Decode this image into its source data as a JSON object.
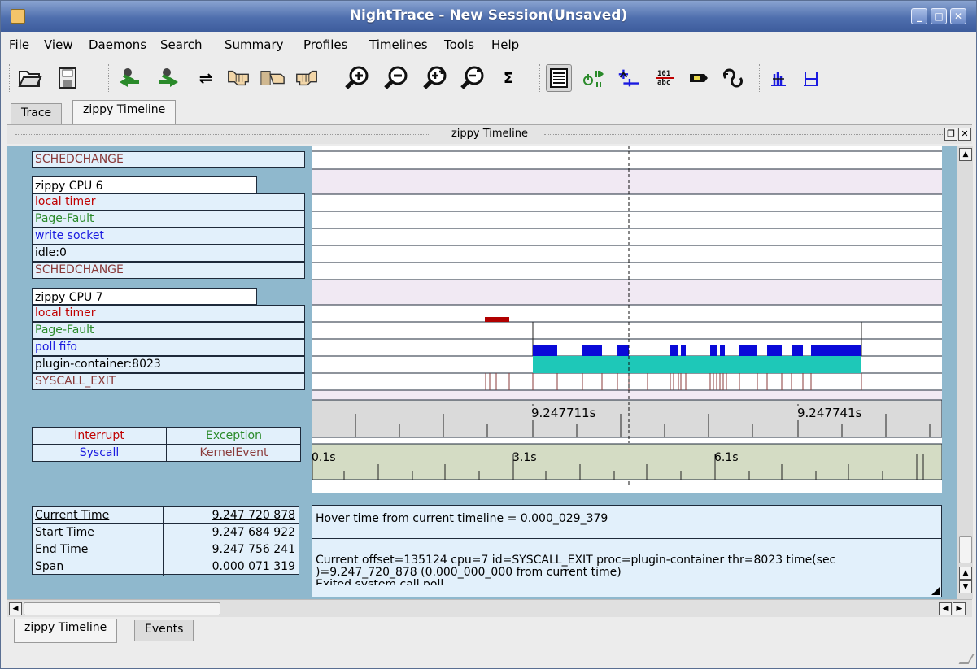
{
  "window": {
    "title": "NightTrace - New Session(Unsaved)"
  },
  "menu": [
    "File",
    "View",
    "Daemons",
    "Search",
    "Summary",
    "Profiles",
    "Timelines",
    "Tools",
    "Help"
  ],
  "toolbar": {
    "buttons": [
      "open-icon",
      "save-icon",
      "goto-prev-icon",
      "goto-next-icon",
      "swap-icon",
      "hand-left-icon",
      "hand-book-icon",
      "hand-right-icon",
      "zoom-in-icon",
      "zoom-out-icon",
      "zoom-in-plus-icon",
      "zoom-out-minus-icon",
      "sigma-icon",
      "list-view-icon",
      "play-pause-icon",
      "event-marker-icon",
      "text-ruler-icon",
      "tag-icon",
      "loop-icon",
      "bar-chart-icon",
      "h-ruler-icon"
    ]
  },
  "tabs": {
    "top": [
      "Trace",
      "zippy Timeline"
    ],
    "bottom": [
      "zippy Timeline",
      "Events"
    ]
  },
  "dock": {
    "title": "zippy Timeline"
  },
  "rows": {
    "cpu5_last": "SCHEDCHANGE",
    "cpu6": {
      "header": "zippy CPU 6",
      "local_timer": "local timer",
      "page_fault": "Page-Fault",
      "write_socket": "write socket",
      "idle": "idle:0",
      "schedchange": "SCHEDCHANGE"
    },
    "cpu7": {
      "header": "zippy CPU 7",
      "local_timer": "local timer",
      "page_fault": "Page-Fault",
      "poll_fifo": "poll fifo",
      "proc": "plugin-container:8023",
      "syscall_exit": "SYSCALL_EXIT"
    }
  },
  "ruler": {
    "tick1": "9.247711s",
    "tick2": "9.247741s"
  },
  "overview": {
    "tick0": "0.1s",
    "tick1": "3.1s",
    "tick2": "6.1s"
  },
  "legend": {
    "interrupt": "Interrupt",
    "exception": "Exception",
    "syscall": "Syscall",
    "kernel_event": "KernelEvent"
  },
  "times": {
    "current_label": "Current Time",
    "current_value": "9.247 720 878",
    "start_label": "Start Time",
    "start_value": "9.247 684 922",
    "end_label": "End Time",
    "end_value": "9.247 756 241",
    "span_label": "Span",
    "span_value": "0.000 071 319"
  },
  "hover": {
    "line1": "Hover time from current timeline = 0.000_029_379",
    "line2": "Current offset=135124  cpu=7  id=SYSCALL_EXIT  proc=plugin-container  thr=8023  time(sec",
    "line3": ")=9.247_720_878   (0.000_000_000 from current time)",
    "line4": "Exited system call poll"
  },
  "colors": {
    "interrupt": "#c00000",
    "exception": "#2a8a2a",
    "syscall": "#1a1ae0",
    "kernel_event": "#8a3a3a",
    "blue_bar": "#0a0ad8",
    "cyan_bar": "#1ec8b8",
    "red_bar": "#b00000"
  }
}
